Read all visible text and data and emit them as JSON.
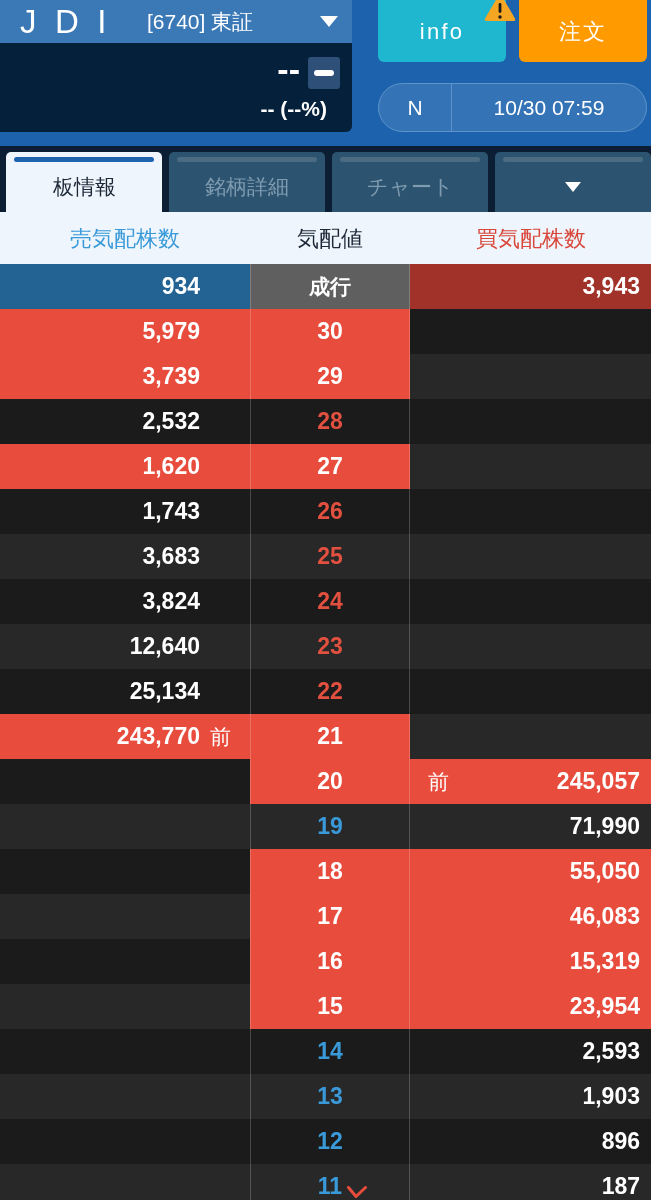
{
  "header": {
    "ticker": "J D I",
    "code_market": "[6740] 東証",
    "price": "--",
    "change": "-- (--%)"
  },
  "buttons": [
    {
      "label": "info",
      "kind": "info",
      "alert": true
    },
    {
      "label": "注文",
      "kind": "order",
      "alert": false
    }
  ],
  "session": {
    "label": "N",
    "datetime": "10/30 07:59"
  },
  "tabs": [
    {
      "kind": "text",
      "label": "板情報",
      "selected": true
    },
    {
      "kind": "text",
      "label": "銘柄詳細",
      "selected": false
    },
    {
      "kind": "text",
      "label": "チャート",
      "selected": false
    },
    {
      "kind": "menu",
      "selected": false
    }
  ],
  "columns": [
    {
      "label": "売気配株数",
      "color": "#3a9ad9"
    },
    {
      "label": "気配値",
      "color": "#1d2838"
    },
    {
      "label": "買気配株数",
      "color": "#d9473a"
    }
  ],
  "market_order": {
    "ask": "934",
    "price": "成行",
    "bid": "3,943"
  },
  "rows": [
    {
      "price": "30",
      "price_highlighted": true,
      "ask": "5,979",
      "ask_highlighted": true,
      "bid_highlighted": false,
      "marked": false
    },
    {
      "price": "29",
      "price_highlighted": true,
      "ask": "3,739",
      "ask_highlighted": true,
      "bid_highlighted": false,
      "marked": false
    },
    {
      "price": "28",
      "price_highlighted": false,
      "color": "#e2503f",
      "ask": "2,532",
      "ask_highlighted": false,
      "bid_highlighted": false,
      "marked": false
    },
    {
      "price": "27",
      "price_highlighted": true,
      "ask": "1,620",
      "ask_highlighted": true,
      "bid_highlighted": false,
      "marked": false
    },
    {
      "price": "26",
      "price_highlighted": false,
      "color": "#e2503f",
      "ask": "1,743",
      "ask_highlighted": false,
      "bid_highlighted": false,
      "marked": false
    },
    {
      "price": "25",
      "price_highlighted": false,
      "color": "#e2503f",
      "ask": "3,683",
      "ask_highlighted": false,
      "bid_highlighted": false,
      "marked": false
    },
    {
      "price": "24",
      "price_highlighted": false,
      "color": "#e2503f",
      "ask": "3,824",
      "ask_highlighted": false,
      "bid_highlighted": false,
      "marked": false
    },
    {
      "price": "23",
      "price_highlighted": false,
      "color": "#e2503f",
      "ask": "12,640",
      "ask_highlighted": false,
      "bid_highlighted": false,
      "marked": false
    },
    {
      "price": "22",
      "price_highlighted": false,
      "color": "#e2503f",
      "ask": "25,134",
      "ask_highlighted": false,
      "bid_highlighted": false,
      "marked": false
    },
    {
      "price": "21",
      "price_highlighted": true,
      "ask": "243,770",
      "ask_marker": "前",
      "ask_highlighted": true,
      "bid_highlighted": false,
      "marked": false
    },
    {
      "price": "20",
      "price_highlighted": true,
      "ask_highlighted": false,
      "bid": "245,057",
      "bid_marker": "前",
      "bid_highlighted": true,
      "marked": false
    },
    {
      "price": "19",
      "price_highlighted": false,
      "color": "#3a9ad9",
      "ask_highlighted": false,
      "bid": "71,990",
      "bid_highlighted": false,
      "marked": false
    },
    {
      "price": "18",
      "price_highlighted": true,
      "ask_highlighted": false,
      "bid": "55,050",
      "bid_highlighted": true,
      "marked": false
    },
    {
      "price": "17",
      "price_highlighted": true,
      "ask_highlighted": false,
      "bid": "46,083",
      "bid_highlighted": true,
      "marked": false
    },
    {
      "price": "16",
      "price_highlighted": true,
      "ask_highlighted": false,
      "bid": "15,319",
      "bid_highlighted": true,
      "marked": false
    },
    {
      "price": "15",
      "price_highlighted": true,
      "ask_highlighted": false,
      "bid": "23,954",
      "bid_highlighted": true,
      "marked": false
    },
    {
      "price": "14",
      "price_highlighted": false,
      "color": "#3a9ad9",
      "ask_highlighted": false,
      "bid": "2,593",
      "bid_highlighted": false,
      "marked": false
    },
    {
      "price": "13",
      "price_highlighted": false,
      "color": "#3a9ad9",
      "ask_highlighted": false,
      "bid": "1,903",
      "bid_highlighted": false,
      "marked": false
    },
    {
      "price": "12",
      "price_highlighted": false,
      "color": "#3a9ad9",
      "ask_highlighted": false,
      "bid": "896",
      "bid_highlighted": false,
      "marked": false
    },
    {
      "price": "11",
      "price_highlighted": false,
      "color": "#3a9ad9",
      "ask_highlighted": false,
      "bid": "187",
      "bid_highlighted": false,
      "marked": true
    }
  ]
}
